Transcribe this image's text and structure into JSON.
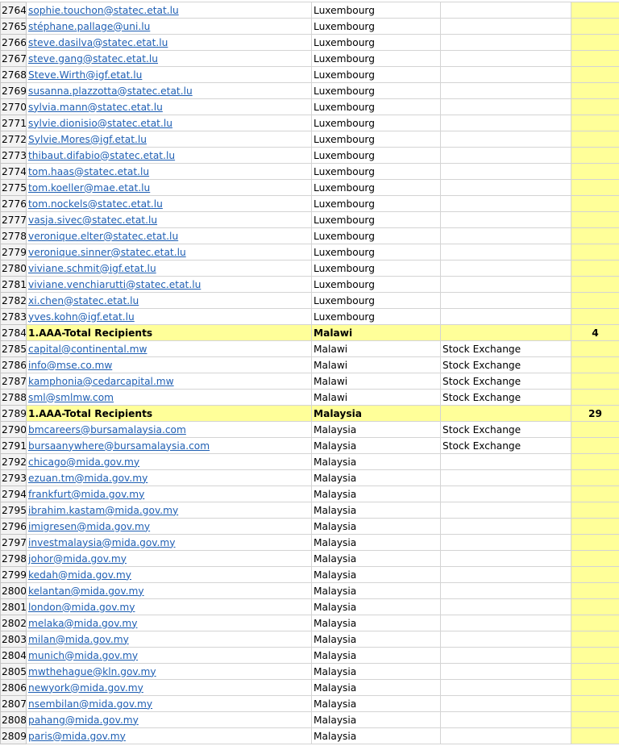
{
  "rows": [
    {
      "n": "2764",
      "email": "sophie.touchon@statec.etat.lu",
      "country": "Luxembourg",
      "type": "",
      "count": "",
      "total": false
    },
    {
      "n": "2765",
      "email": "stéphane.pallage@uni.lu",
      "country": "Luxembourg",
      "type": "",
      "count": "",
      "total": false
    },
    {
      "n": "2766",
      "email": "steve.dasilva@statec.etat.lu",
      "country": "Luxembourg",
      "type": "",
      "count": "",
      "total": false
    },
    {
      "n": "2767",
      "email": "steve.gang@statec.etat.lu",
      "country": "Luxembourg",
      "type": "",
      "count": "",
      "total": false
    },
    {
      "n": "2768",
      "email": "Steve.Wirth@igf.etat.lu",
      "country": "Luxembourg",
      "type": "",
      "count": "",
      "total": false
    },
    {
      "n": "2769",
      "email": "susanna.plazzotta@statec.etat.lu",
      "country": "Luxembourg",
      "type": "",
      "count": "",
      "total": false
    },
    {
      "n": "2770",
      "email": "sylvia.mann@statec.etat.lu",
      "country": "Luxembourg",
      "type": "",
      "count": "",
      "total": false
    },
    {
      "n": "2771",
      "email": "sylvie.dionisio@statec.etat.lu",
      "country": "Luxembourg",
      "type": "",
      "count": "",
      "total": false
    },
    {
      "n": "2772",
      "email": "Sylvie.Mores@igf.etat.lu",
      "country": "Luxembourg",
      "type": "",
      "count": "",
      "total": false
    },
    {
      "n": "2773",
      "email": "thibaut.difabio@statec.etat.lu",
      "country": "Luxembourg",
      "type": "",
      "count": "",
      "total": false
    },
    {
      "n": "2774",
      "email": "tom.haas@statec.etat.lu",
      "country": "Luxembourg",
      "type": "",
      "count": "",
      "total": false
    },
    {
      "n": "2775",
      "email": "tom.koeller@mae.etat.lu",
      "country": "Luxembourg",
      "type": "",
      "count": "",
      "total": false
    },
    {
      "n": "2776",
      "email": "tom.nockels@statec.etat.lu",
      "country": "Luxembourg",
      "type": "",
      "count": "",
      "total": false
    },
    {
      "n": "2777",
      "email": "vasja.sivec@statec.etat.lu",
      "country": "Luxembourg",
      "type": "",
      "count": "",
      "total": false
    },
    {
      "n": "2778",
      "email": "veronique.elter@statec.etat.lu",
      "country": "Luxembourg",
      "type": "",
      "count": "",
      "total": false
    },
    {
      "n": "2779",
      "email": "veronique.sinner@statec.etat.lu",
      "country": "Luxembourg",
      "type": "",
      "count": "",
      "total": false
    },
    {
      "n": "2780",
      "email": "viviane.schmit@igf.etat.lu",
      "country": "Luxembourg",
      "type": "",
      "count": "",
      "total": false
    },
    {
      "n": "2781",
      "email": "viviane.venchiarutti@statec.etat.lu",
      "country": "Luxembourg",
      "type": "",
      "count": "",
      "total": false
    },
    {
      "n": "2782",
      "email": "xi.chen@statec.etat.lu",
      "country": "Luxembourg",
      "type": "",
      "count": "",
      "total": false
    },
    {
      "n": "2783",
      "email": "yves.kohn@igf.etat.lu",
      "country": "Luxembourg",
      "type": "",
      "count": "",
      "total": false
    },
    {
      "n": "2784",
      "email": "1.AAA-Total Recipients",
      "country": "Malawi",
      "type": "",
      "count": "4",
      "total": true
    },
    {
      "n": "2785",
      "email": "capital@continental.mw",
      "country": "Malawi",
      "type": "Stock Exchange",
      "count": "",
      "total": false
    },
    {
      "n": "2786",
      "email": "info@mse.co.mw",
      "country": "Malawi",
      "type": "Stock Exchange",
      "count": "",
      "total": false
    },
    {
      "n": "2787",
      "email": "kamphonia@cedarcapital.mw",
      "country": "Malawi",
      "type": "Stock Exchange",
      "count": "",
      "total": false
    },
    {
      "n": "2788",
      "email": "sml@smlmw.com",
      "country": "Malawi",
      "type": "Stock Exchange",
      "count": "",
      "total": false
    },
    {
      "n": "2789",
      "email": "1.AAA-Total Recipients",
      "country": "Malaysia",
      "type": "",
      "count": "29",
      "total": true
    },
    {
      "n": "2790",
      "email": "bmcareers@bursamalaysia.com",
      "country": "Malaysia",
      "type": "Stock Exchange",
      "count": "",
      "total": false
    },
    {
      "n": "2791",
      "email": "bursaanywhere@bursamalaysia.com",
      "country": "Malaysia",
      "type": "Stock Exchange",
      "count": "",
      "total": false
    },
    {
      "n": "2792",
      "email": "chicago@mida.gov.my",
      "country": "Malaysia",
      "type": "",
      "count": "",
      "total": false
    },
    {
      "n": "2793",
      "email": "ezuan.tm@mida.gov.my",
      "country": "Malaysia",
      "type": "",
      "count": "",
      "total": false
    },
    {
      "n": "2794",
      "email": "frankfurt@mida.gov.my",
      "country": "Malaysia",
      "type": "",
      "count": "",
      "total": false
    },
    {
      "n": "2795",
      "email": "ibrahim.kastam@mida.gov.my",
      "country": "Malaysia",
      "type": "",
      "count": "",
      "total": false
    },
    {
      "n": "2796",
      "email": "imigresen@mida.gov.my",
      "country": "Malaysia",
      "type": "",
      "count": "",
      "total": false
    },
    {
      "n": "2797",
      "email": "investmalaysia@mida.gov.my",
      "country": "Malaysia",
      "type": "",
      "count": "",
      "total": false
    },
    {
      "n": "2798",
      "email": "johor@mida.gov.my",
      "country": "Malaysia",
      "type": "",
      "count": "",
      "total": false
    },
    {
      "n": "2799",
      "email": "kedah@mida.gov.my",
      "country": "Malaysia",
      "type": "",
      "count": "",
      "total": false
    },
    {
      "n": "2800",
      "email": "kelantan@mida.gov.my",
      "country": "Malaysia",
      "type": "",
      "count": "",
      "total": false
    },
    {
      "n": "2801",
      "email": "london@mida.gov.my",
      "country": "Malaysia",
      "type": "",
      "count": "",
      "total": false
    },
    {
      "n": "2802",
      "email": "melaka@mida.gov.my",
      "country": "Malaysia",
      "type": "",
      "count": "",
      "total": false
    },
    {
      "n": "2803",
      "email": "milan@mida.gov.my",
      "country": "Malaysia",
      "type": "",
      "count": "",
      "total": false
    },
    {
      "n": "2804",
      "email": "munich@mida.gov.my",
      "country": "Malaysia",
      "type": "",
      "count": "",
      "total": false
    },
    {
      "n": "2805",
      "email": "mwthehague@kln.gov.my",
      "country": "Malaysia",
      "type": "",
      "count": "",
      "total": false
    },
    {
      "n": "2806",
      "email": "newyork@mida.gov.my",
      "country": "Malaysia",
      "type": "",
      "count": "",
      "total": false
    },
    {
      "n": "2807",
      "email": "nsembilan@mida.gov.my",
      "country": "Malaysia",
      "type": "",
      "count": "",
      "total": false
    },
    {
      "n": "2808",
      "email": "pahang@mida.gov.my",
      "country": "Malaysia",
      "type": "",
      "count": "",
      "total": false
    },
    {
      "n": "2809",
      "email": "paris@mida.gov.my",
      "country": "Malaysia",
      "type": "",
      "count": "",
      "total": false
    }
  ],
  "colors": {
    "link": "#1f5fb3",
    "highlight": "#ffff99",
    "gridline": "#d4d4d4"
  }
}
